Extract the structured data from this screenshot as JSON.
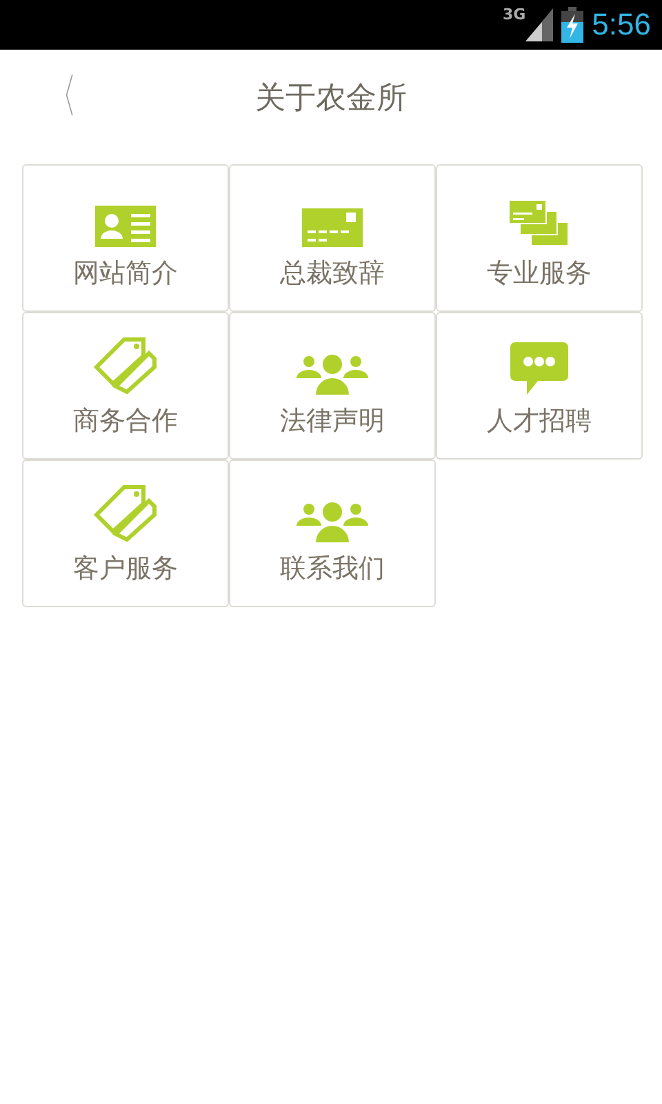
{
  "status_bar": {
    "network": "3G",
    "time": "5:56"
  },
  "header": {
    "back": "〈",
    "title": "关于农金所"
  },
  "tiles": [
    {
      "label": "网站简介",
      "kind": "idcard"
    },
    {
      "label": "总裁致辞",
      "kind": "card"
    },
    {
      "label": "专业服务",
      "kind": "cards"
    },
    {
      "label": "商务合作",
      "kind": "tags"
    },
    {
      "label": "法律声明",
      "kind": "people"
    },
    {
      "label": "人才招聘",
      "kind": "chat"
    },
    {
      "label": "客户服务",
      "kind": "tags"
    },
    {
      "label": "联系我们",
      "kind": "people"
    }
  ]
}
